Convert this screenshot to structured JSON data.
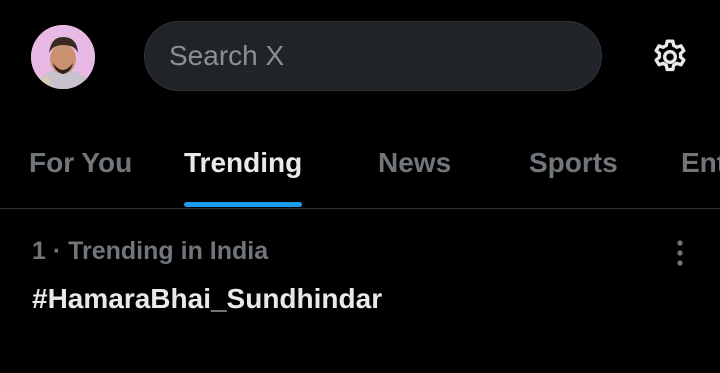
{
  "search": {
    "placeholder": "Search X"
  },
  "tabs": [
    {
      "label": "For You",
      "active": false
    },
    {
      "label": "Trending",
      "active": true
    },
    {
      "label": "News",
      "active": false
    },
    {
      "label": "Sports",
      "active": false
    },
    {
      "label": "Ent",
      "active": false
    }
  ],
  "trends": [
    {
      "meta": "1 · Trending in India",
      "title": "#HamaraBhai_Sundhindar"
    }
  ],
  "icons": {
    "settings": "gear-icon",
    "more": "more-vertical-icon",
    "avatar": "user-avatar"
  },
  "colors": {
    "background": "#000000",
    "accent": "#1d9bf0",
    "text_primary": "#e7e9ea",
    "text_secondary": "#71767b",
    "search_bg": "#202327"
  }
}
